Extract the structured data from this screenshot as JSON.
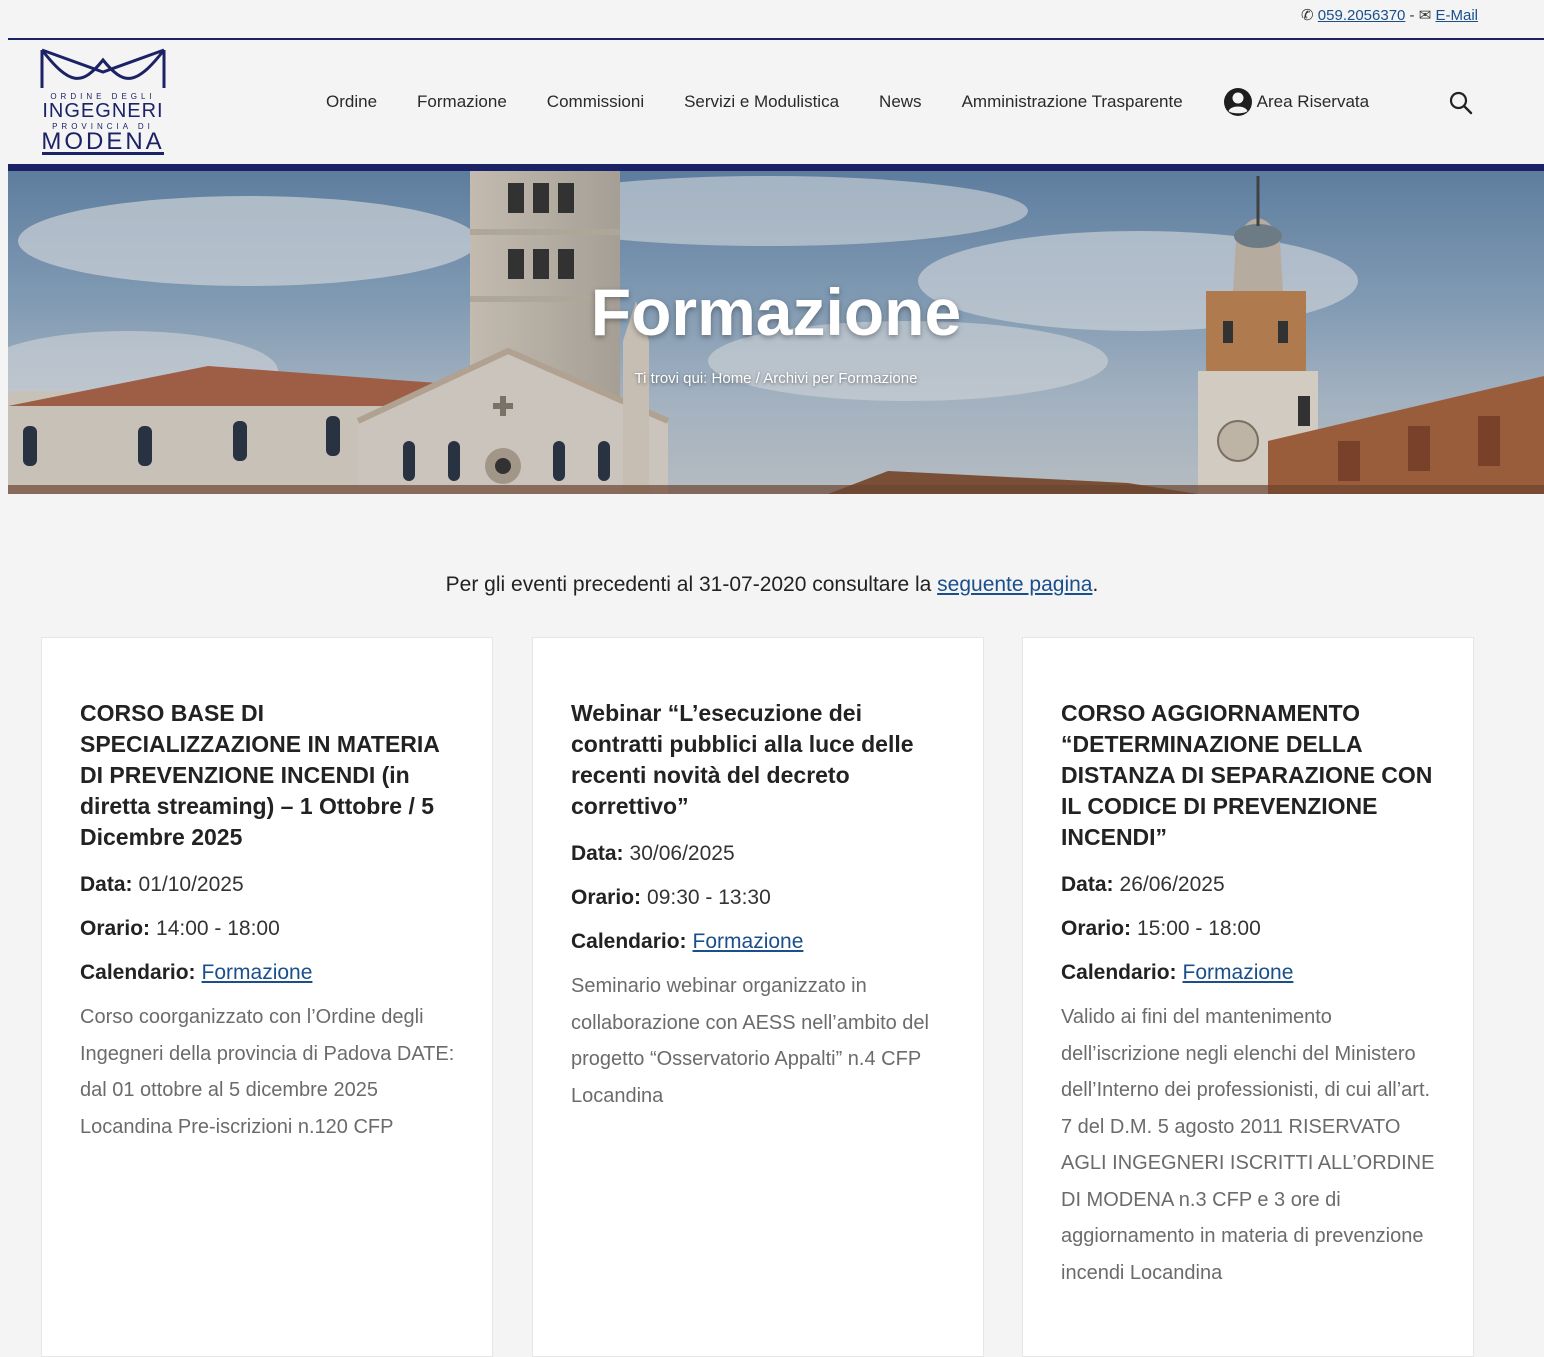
{
  "contact": {
    "phone": "059.2056370",
    "separator": " - ",
    "email_label": "E-Mail"
  },
  "logo": {
    "line1": "ORDINE DEGLI",
    "line2": "INGEGNERI",
    "line3": "PROVINCIA DI",
    "line4": "MODENA"
  },
  "nav": {
    "items": [
      "Ordine",
      "Formazione",
      "Commissioni",
      "Servizi e Modulistica",
      "News",
      "Amministrazione Trasparente"
    ],
    "area_riservata": "Area Riservata"
  },
  "hero": {
    "title": "Formazione",
    "breadcrumb_prefix": "Ti trovi qui: ",
    "breadcrumb_home": "Home",
    "breadcrumb_sep": " / ",
    "breadcrumb_current": "Archivi per Formazione"
  },
  "intro": {
    "text": "Per gli eventi precedenti al 31-07-2020 consultare la ",
    "link": "seguente pagina",
    "end": "."
  },
  "labels": {
    "data": "Data:",
    "orario": "Orario:",
    "calendario": "Calendario:"
  },
  "cards": [
    {
      "title": "CORSO BASE DI SPECIALIZZAZIONE IN MATERIA DI PREVENZIONE INCENDI (in diretta streaming) – 1 Ottobre / 5 Dicembre 2025",
      "data": "01/10/2025",
      "orario": "14:00 - 18:00",
      "calendario": "Formazione",
      "description": "Corso coorganizzato con l’Ordine degli Ingegneri della provincia di Padova DATE: dal 01 ottobre al 5 dicembre 2025 Locandina Pre-iscrizioni n.120 CFP"
    },
    {
      "title": "Webinar “L’esecuzione dei contratti pubblici alla luce delle recenti novità del decreto correttivo”",
      "data": "30/06/2025",
      "orario": "09:30 - 13:30",
      "calendario": "Formazione",
      "description": "Seminario webinar organizzato in collaborazione con AESS nell’ambito del progetto “Osservatorio Appalti” n.4 CFP Locandina"
    },
    {
      "title": "CORSO AGGIORNAMENTO “DETERMINAZIONE DELLA DISTANZA DI SEPARAZIONE CON IL CODICE DI PREVENZIONE INCENDI”",
      "data": "26/06/2025",
      "orario": "15:00 - 18:00",
      "calendario": "Formazione",
      "description": "Valido ai fini del mantenimento dell’iscrizione negli elenchi del Ministero dell’Interno dei professionisti, di cui all’art. 7 del D.M. 5 agosto 2011 RISERVATO AGLI INGEGNERI ISCRITTI ALL’ORDINE DI MODENA n.3 CFP e 3 ore di aggiornamento in materia di prevenzione incendi Locandina"
    }
  ]
}
